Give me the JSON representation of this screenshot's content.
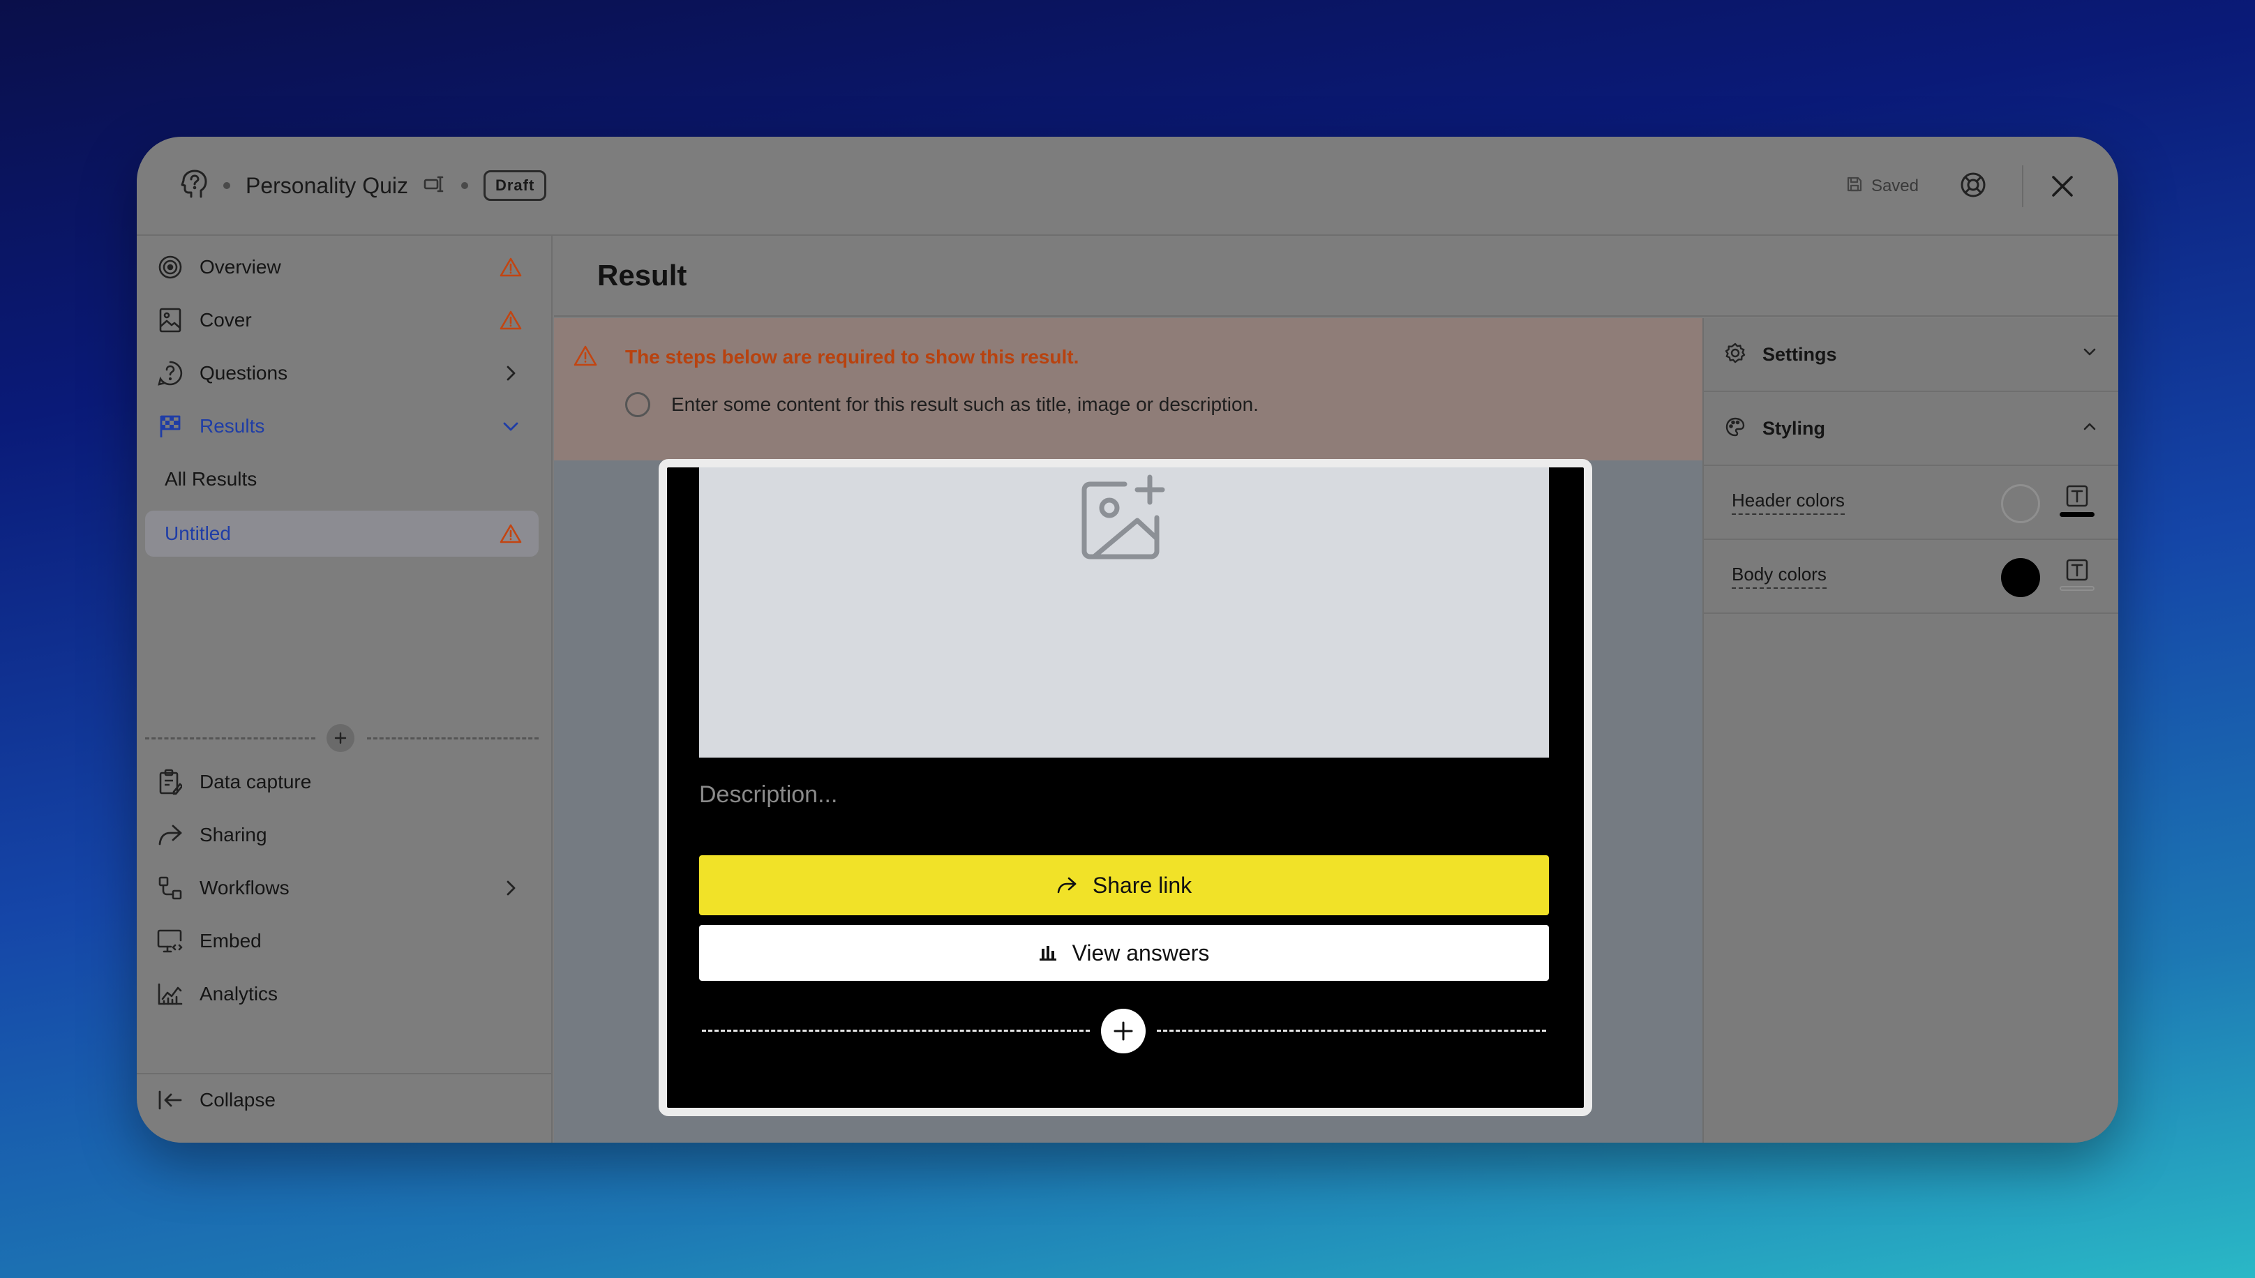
{
  "header": {
    "quiz_title": "Personality Quiz",
    "status_badge": "Draft",
    "save_status": "Saved"
  },
  "sidebar": {
    "items": [
      {
        "label": "Overview",
        "icon": "target-icon",
        "warning": true
      },
      {
        "label": "Cover",
        "icon": "cover-image-icon",
        "warning": true
      },
      {
        "label": "Questions",
        "icon": "question-circle-icon",
        "chevron": "right"
      },
      {
        "label": "Results",
        "icon": "flag-icon",
        "chevron": "down",
        "active": true
      },
      {
        "label": "All Results"
      },
      {
        "label": "Untitled",
        "warning": true,
        "selected": true
      },
      {
        "label": "Data capture",
        "icon": "clipboard-icon"
      },
      {
        "label": "Sharing",
        "icon": "share-arrow-icon"
      },
      {
        "label": "Workflows",
        "icon": "workflow-icon",
        "chevron": "right"
      },
      {
        "label": "Embed",
        "icon": "monitor-code-icon"
      },
      {
        "label": "Analytics",
        "icon": "analytics-chart-icon"
      }
    ],
    "collapse_label": "Collapse"
  },
  "main": {
    "title": "Result",
    "alert": {
      "title": "The steps below are required to show this result.",
      "steps": [
        "Enter some content for this result such as title, image or description."
      ]
    },
    "preview": {
      "description_placeholder": "Description...",
      "share_button": "Share link",
      "view_answers_button": "View answers"
    }
  },
  "panel": {
    "settings_label": "Settings",
    "styling_label": "Styling",
    "header_colors_label": "Header colors",
    "body_colors_label": "Body colors"
  },
  "colors": {
    "accent_blue": "#1f3da6",
    "warning_orange": "#c24512",
    "share_button_yellow": "#f1e228",
    "preview_background": "#000000"
  }
}
